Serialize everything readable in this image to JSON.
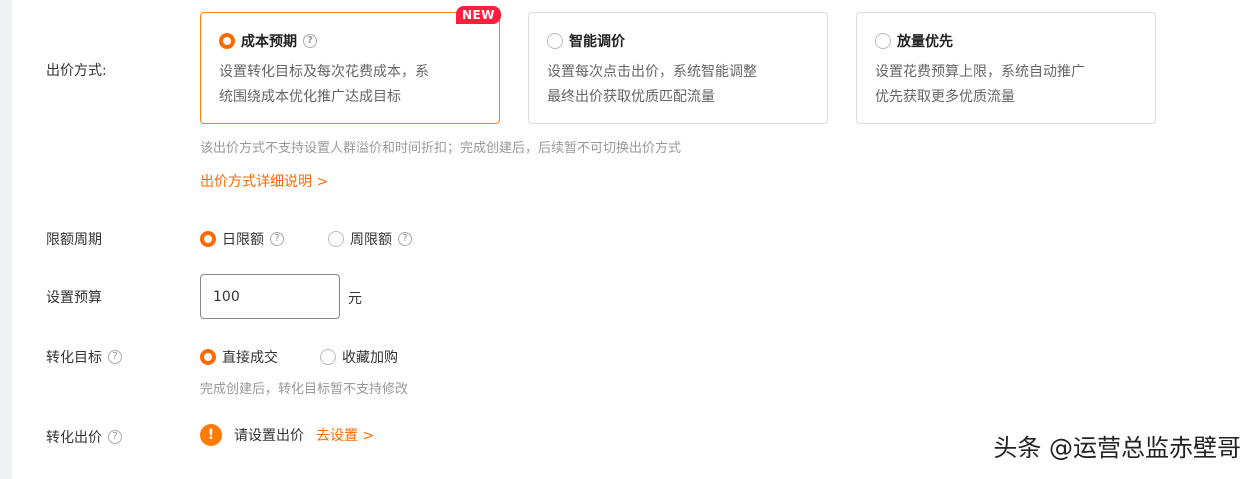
{
  "bid_method": {
    "label": "出价方式:",
    "options": [
      {
        "title": "成本预期",
        "desc_line1": "设置转化目标及每次花费成本，系",
        "desc_line2": "统围绕成本优化推广达成目标",
        "badge": "NEW",
        "selected": true
      },
      {
        "title": "智能调价",
        "desc_line1": "设置每次点击出价，系统智能调整",
        "desc_line2": "最终出价获取优质匹配流量",
        "selected": false
      },
      {
        "title": "放量优先",
        "desc_line1": "设置花费预算上限，系统自动推广",
        "desc_line2": "优先获取更多优质流量",
        "selected": false
      }
    ],
    "note": "该出价方式不支持设置人群溢价和时间折扣；完成创建后，后续暂不可切换出价方式",
    "detail_link": "出价方式详细说明 >"
  },
  "limit_period": {
    "label": "限额周期",
    "options": [
      {
        "label": "日限额",
        "selected": true
      },
      {
        "label": "周限额",
        "selected": false
      }
    ]
  },
  "budget": {
    "label": "设置预算",
    "value": "100",
    "unit": "元"
  },
  "conversion_goal": {
    "label": "转化目标",
    "options": [
      {
        "label": "直接成交",
        "selected": true
      },
      {
        "label": "收藏加购",
        "selected": false
      }
    ],
    "note": "完成创建后，转化目标暂不支持修改"
  },
  "conversion_bid": {
    "label": "转化出价",
    "warning_icon": "!",
    "warning_text": "请设置出价",
    "link": "去设置 >"
  },
  "watermark": "头条 @运营总监赤壁哥",
  "colors": {
    "accent": "#ff6a00",
    "badge": "#ff1e3c",
    "selected_border": "#ff7a1a"
  },
  "icons": {
    "help": "?"
  }
}
